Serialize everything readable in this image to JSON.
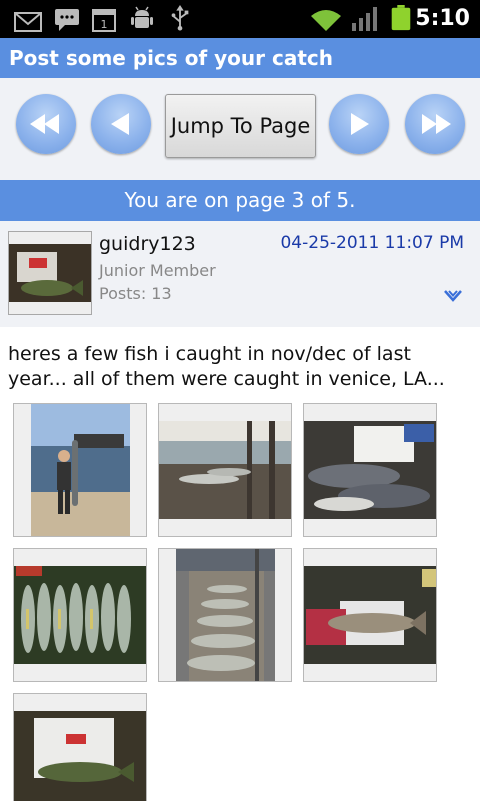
{
  "status_bar": {
    "time": "5:10",
    "icons": [
      "gmail-icon",
      "messaging-icon",
      "calendar-icon",
      "android-debug-icon",
      "usb-icon",
      "wifi-icon",
      "signal-icon",
      "battery-icon"
    ]
  },
  "header": {
    "title": "Post some pics of your catch"
  },
  "navigation": {
    "first_icon": "double-left-arrow",
    "prev_icon": "left-arrow",
    "jump_label": "Jump To Page",
    "next_icon": "right-arrow",
    "last_icon": "double-right-arrow"
  },
  "page_indicator": "You are on page 3 of 5.",
  "post": {
    "username": "guidry123",
    "rank": "Junior Member",
    "posts": "Posts: 13",
    "date": "04-25-2011 11:07 PM",
    "body": "heres a few fish i caught in nov/dec of last year... all of them were caught in venice, LA...",
    "attachments": [
      "photo-man-holding-fish-on-dock",
      "photo-fish-on-pier-rail",
      "photo-fish-on-cooler",
      "photo-row-of-fish-on-ground",
      "photo-fish-laid-on-pier",
      "photo-fish-on-tray",
      "photo-fish-in-cooler"
    ]
  },
  "colors": {
    "accent_bar": "#5a8fe0",
    "nav_button": "#8db3ec",
    "date_text": "#1a3aa8",
    "panel_bg": "#f0f2f6"
  }
}
